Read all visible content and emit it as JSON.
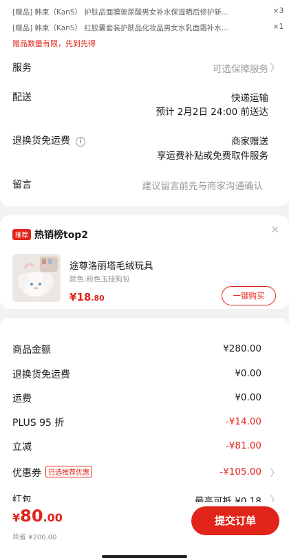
{
  "gifts": [
    {
      "tag": "[赠品]",
      "brand": "韩束（KanS）",
      "name": "护肤品面膜玻尿酸男女补水保湿晒后修护新...",
      "qty": "×3"
    },
    {
      "tag": "[赠品]",
      "brand": "韩束（KanS）",
      "name": "红胶囊套装护肤品化妆品男女水乳面霜补水...",
      "qty": "×1"
    }
  ],
  "gift_notice": "赠品数量有限，先到先得",
  "service": {
    "label": "服务",
    "value": "可选保障服务"
  },
  "delivery": {
    "label": "配送",
    "method": "快递运输",
    "eta": "预计 2月2日 24:00 前送达"
  },
  "return_shipping": {
    "label": "退换货免运费",
    "line1": "商家赠送",
    "line2": "享运费补贴或免费取件服务"
  },
  "message": {
    "label": "留言",
    "placeholder": "建议留言前先与商家沟通确认"
  },
  "recommend": {
    "tag": "推荐",
    "title": "热销榜top2",
    "product_name": "途尊洛丽塔毛绒玩具",
    "product_spec": "颜色:粉色玉桂狗包",
    "price_symbol": "¥",
    "price_int": "18",
    "price_dec": ".80",
    "buy_label": "一键购买"
  },
  "summary": [
    {
      "label": "商品金额",
      "value": "¥280.00",
      "red": false
    },
    {
      "label": "退换货免运费",
      "value": "¥0.00",
      "red": false
    },
    {
      "label": "运费",
      "value": "¥0.00",
      "red": false
    },
    {
      "label": "PLUS 95 折",
      "value": "-¥14.00",
      "red": true
    },
    {
      "label": "立减",
      "value": "-¥81.00",
      "red": true
    },
    {
      "label": "优惠券",
      "badge": "已选推荐优惠",
      "value": "-¥105.00",
      "red": true
    },
    {
      "label": "红包",
      "value": "最高可抵 ¥0.18",
      "red": false
    }
  ],
  "footer": {
    "currency": "¥",
    "total_int": "80",
    "total_dec": ".00",
    "saved": "共省 ¥200.00",
    "submit": "提交订单"
  },
  "colors": {
    "accent": "#e1251b",
    "bg": "#f2f2f2"
  }
}
